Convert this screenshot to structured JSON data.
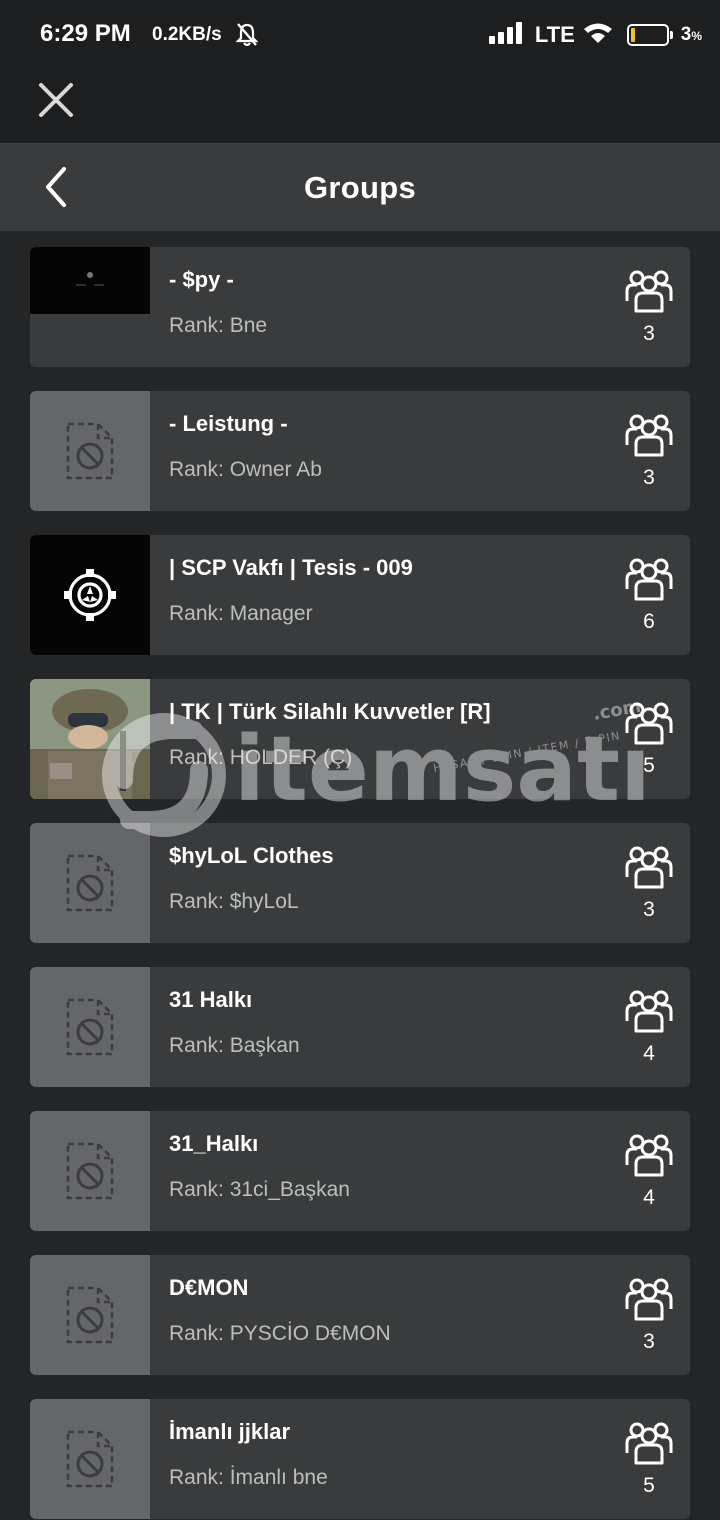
{
  "status_bar": {
    "time": "6:29 PM",
    "speed": "0.2KB/s",
    "network": "LTE",
    "battery_percent": "3",
    "battery_unit": "%",
    "icons": [
      "mute-icon",
      "signal-icon",
      "wifi-icon",
      "battery-icon"
    ]
  },
  "header": {
    "title": "Groups",
    "close_icon": "close-icon",
    "back_icon": "chevron-left-icon"
  },
  "groups": [
    {
      "name": "- $py -",
      "rank": "Rank: Bne",
      "members": "3",
      "thumb": "dark"
    },
    {
      "name": "- Leistung -",
      "rank": "Rank: Owner Ab",
      "members": "3",
      "thumb": "placeholder"
    },
    {
      "name": "| SCP Vakfı | Tesis - 009",
      "rank": "Rank: Manager",
      "members": "6",
      "thumb": "scp-logo"
    },
    {
      "name": "| TK | Türk Silahlı Kuvvetler [R]",
      "rank": "Rank: HOLDER (Ç)",
      "members": "5",
      "thumb": "photo"
    },
    {
      "name": "$hyLoL Clothes",
      "rank": "Rank: $hyLoL",
      "members": "3",
      "thumb": "placeholder"
    },
    {
      "name": "31 Halkı",
      "rank": "Rank: Başkan",
      "members": "4",
      "thumb": "placeholder"
    },
    {
      "name": "31_Halkı",
      "rank": "Rank: 31ci_Başkan",
      "members": "4",
      "thumb": "placeholder"
    },
    {
      "name": "D€MON",
      "rank": "Rank: PYSCİO D€MON",
      "members": "3",
      "thumb": "placeholder"
    },
    {
      "name": "İmanlı jjklar",
      "rank": "Rank: İmanlı bne",
      "members": "5",
      "thumb": "placeholder"
    }
  ],
  "watermark": {
    "brand": "itemsatış",
    "domain": ".com",
    "tagline": "HESAP / SKIN / ITEM / E-PIN"
  }
}
